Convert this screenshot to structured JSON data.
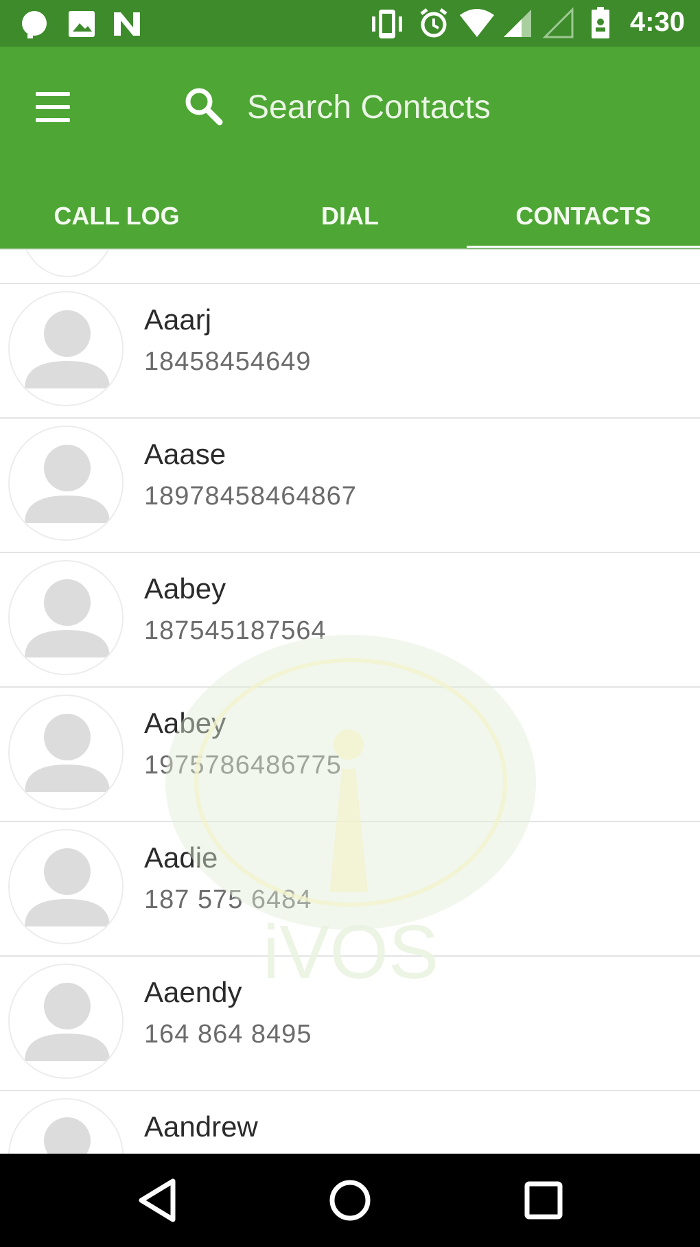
{
  "status_bar": {
    "time": "4:30",
    "left_icons": [
      "chat-bubble-icon",
      "image-icon",
      "n-icon"
    ],
    "right_icons": [
      "vibrate-icon",
      "alarm-icon",
      "wifi-icon",
      "signal-icon",
      "signal-empty-icon",
      "battery-icon"
    ]
  },
  "toolbar": {
    "menu_icon": "menu-icon",
    "search_icon": "search-icon",
    "search_placeholder": "Search Contacts"
  },
  "tabs": [
    {
      "label": "CALL LOG",
      "selected": false
    },
    {
      "label": "DIAL",
      "selected": false
    },
    {
      "label": "CONTACTS",
      "selected": true
    }
  ],
  "contacts": [
    {
      "name": "Aaarj",
      "number": "18458454649"
    },
    {
      "name": "Aaase",
      "number": "18978458464867"
    },
    {
      "name": "Aabey",
      "number": "187545187564"
    },
    {
      "name": "Aabey",
      "number": "1975786486775"
    },
    {
      "name": "Aadie",
      "number": "187 575 6484"
    },
    {
      "name": "Aaendy",
      "number": "164 864 8495"
    },
    {
      "name": "Aandrew",
      "number": ""
    }
  ],
  "watermark": {
    "text": "iVOS"
  },
  "nav_bar": {
    "buttons": [
      "back-icon",
      "home-icon",
      "recents-icon"
    ]
  },
  "colors": {
    "app_bar": "#4ea635",
    "status_bar": "#3d8b2a",
    "indicator": "#ffffff",
    "nav_bar": "#000000"
  }
}
